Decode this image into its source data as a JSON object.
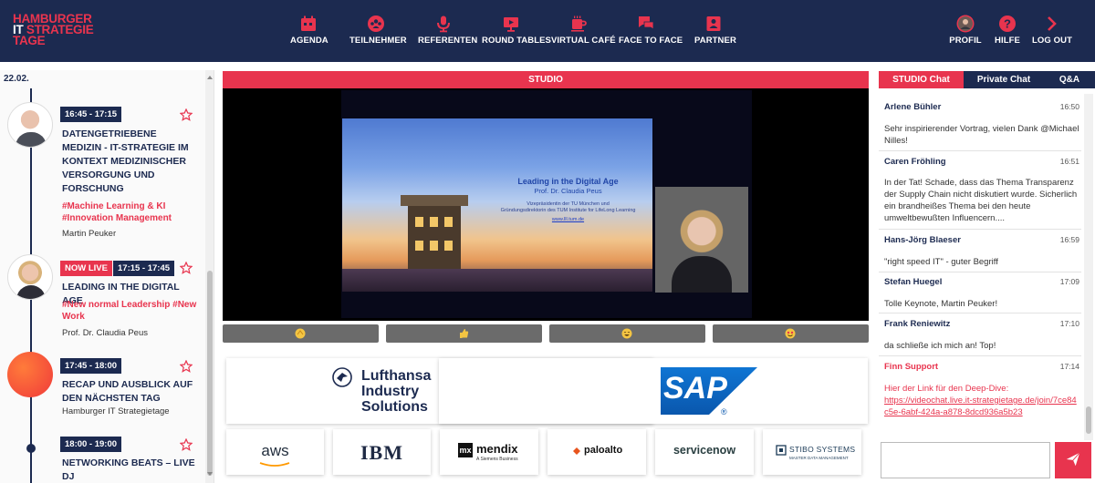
{
  "logo": {
    "line1": "HAMBURGER",
    "line2a": "IT",
    "line2b": "STRATEGIE",
    "line3": "TAGE"
  },
  "nav": {
    "items": [
      {
        "label": "AGENDA",
        "icon": "calendar-icon"
      },
      {
        "label": "TEILNEHMER",
        "icon": "people-icon"
      },
      {
        "label": "REFERENTEN",
        "icon": "microphone-icon"
      },
      {
        "label": "ROUND TABLES",
        "icon": "presentation-icon"
      },
      {
        "label": "VIRTUAL CAFÉ",
        "icon": "coffee-icon"
      },
      {
        "label": "FACE TO FACE",
        "icon": "chat-bubbles-icon"
      },
      {
        "label": "PARTNER",
        "icon": "partner-badge-icon"
      }
    ],
    "right": [
      {
        "label": "PROFIL",
        "icon": "profile-avatar-icon"
      },
      {
        "label": "HILFE",
        "icon": "help-icon"
      },
      {
        "label": "LOG OUT",
        "icon": "chevron-right-icon"
      }
    ]
  },
  "agenda": {
    "date": "22.02.",
    "sessions": [
      {
        "time": "16:45 - 17:15",
        "title": "DATENGETRIEBENE MEDIZIN - IT-STRATEGIE IM KONTEXT MEDIZINISCHER VERSORGUNG UND FORSCHUNG",
        "tags": "#Machine Learning & KI #Innovation Management",
        "speaker": "Martin Peuker"
      },
      {
        "live": "NOW LIVE",
        "time": "17:15 - 17:45",
        "title": "LEADING IN THE DIGITAL AGE",
        "tags": "#New normal Leadership #New Work",
        "speaker": "Prof. Dr. Claudia Peus"
      },
      {
        "time": "17:45 - 18:00",
        "title": "RECAP UND AUSBLICK AUF DEN NÄCHSTEN TAG",
        "speaker": "Hamburger IT Strategietage"
      },
      {
        "time": "18:00 - 19:00",
        "title": "NETWORKING BEATS – LIVE DJ"
      }
    ]
  },
  "studio": {
    "header": "STUDIO",
    "slide": {
      "title": "Leading in the Digital Age",
      "subtitle": "Prof. Dr. Claudia Peus",
      "line1": "Vizepräsidentin der TU München und",
      "line2": "Gründungsdirektorin des TUM Institute for LifeLong Learning",
      "link": "www.lll.tum.de"
    },
    "reactions": [
      "clapping-hands-icon",
      "thumbs-up-icon",
      "laughing-face-icon",
      "heart-eyes-face-icon"
    ]
  },
  "sponsors": {
    "lufthansa": [
      "Lufthansa",
      "Industry",
      "Solutions"
    ],
    "sap": "SAP",
    "small": [
      {
        "name": "aws",
        "color": "#232f3e"
      },
      {
        "name": "IBM",
        "color": "#1f2a44"
      },
      {
        "name": "mendix",
        "color": "#111111"
      },
      {
        "name": "paloalto",
        "color": "#111111"
      },
      {
        "name": "servicenow",
        "color": "#293e40"
      },
      {
        "name": "STIBO SYSTEMS",
        "color": "#1c3b57"
      }
    ],
    "mendix_sub": "A Siemens Business",
    "stibo_sub": "MASTER DATA MANAGEMENT"
  },
  "chat": {
    "tabs": [
      "STUDIO Chat",
      "Private Chat",
      "Q&A"
    ],
    "messages": [
      {
        "name": "Arlene Bühler",
        "time": "16:50",
        "text": "Sehr inspirierender Vortrag, vielen Dank @Michael Nilles!"
      },
      {
        "name": "Caren Fröhling",
        "time": "16:51",
        "text": "In der Tat! Schade, dass das Thema Transparenz der Supply Chain nicht diskutiert wurde. Sicherlich ein brandheißes Thema bei den heute umweltbewußten Influencern...."
      },
      {
        "name": "Hans-Jörg Blaeser",
        "time": "16:59",
        "text": "\"right speed IT\" - guter Begriff"
      },
      {
        "name": "Stefan Huegel",
        "time": "17:09",
        "text": "Tolle Keynote, Martin Peuker!"
      },
      {
        "name": "Frank Reniewitz",
        "time": "17:10",
        "text": "da schließe ich mich an! Top!"
      },
      {
        "name": "Finn Support",
        "time": "17:14",
        "text": "Hier der Link für den Deep-Dive:",
        "link": "https://videochat.live.it-strategietage.de/join/7ce84c5e-6abf-424a-a878-8dcd936a5b23"
      }
    ],
    "input_placeholder": "",
    "send_icon": "paper-plane-icon"
  },
  "colors": {
    "navy": "#1c2a50",
    "accent": "#e8344e"
  }
}
